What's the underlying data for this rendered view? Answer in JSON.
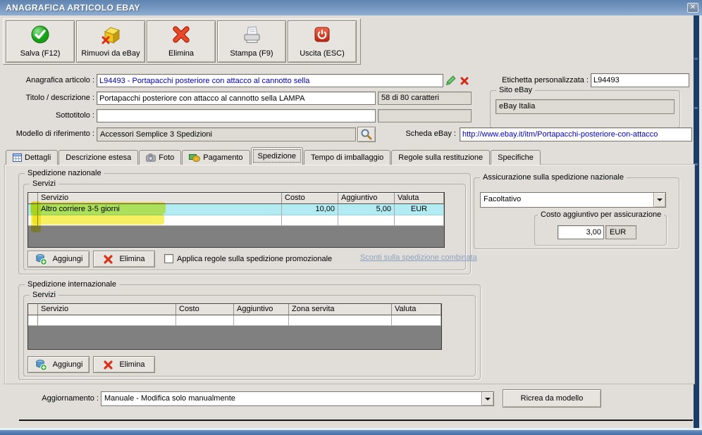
{
  "window": {
    "title": "ANAGRAFICA ARTICOLO EBAY",
    "close_glyph": "✕"
  },
  "toolbar": {
    "buttons": [
      {
        "label": "Salva (F12)",
        "icon": "check-circle-icon"
      },
      {
        "label": "Rimuovi da eBay",
        "icon": "package-remove-icon"
      },
      {
        "label": "Elimina",
        "icon": "red-x-icon"
      },
      {
        "label": "Stampa (F9)",
        "icon": "printer-icon"
      },
      {
        "label": "Uscita (ESC)",
        "icon": "power-icon"
      }
    ]
  },
  "form": {
    "anagrafica_label": "Anagrafica articolo :",
    "anagrafica_value": "L94493 - Portapacchi posteriore con attacco al cannotto sella",
    "etichetta_label": "Etichetta personalizzata :",
    "etichetta_value": "L94493",
    "titolo_label": "Titolo / descrizione :",
    "titolo_value": "Portapacchi posteriore con attacco al cannotto sella LAMPA",
    "titolo_counter": "58 di 80 caratteri",
    "sito_group": "Sito eBay",
    "sito_value": "eBay Italia",
    "sottotitolo_label": "Sottotitolo :",
    "sottotitolo_value": "",
    "modello_label": "Modello di riferimento :",
    "modello_value": "Accessori Semplice 3 Spedizioni",
    "scheda_label": "Scheda eBay :",
    "scheda_value": "http://www.ebay.it/itm/Portapacchi-posteriore-con-attacco"
  },
  "tabs": {
    "items": [
      {
        "label": "Dettagli"
      },
      {
        "label": "Descrizione estesa"
      },
      {
        "label": "Foto"
      },
      {
        "label": "Pagamento"
      },
      {
        "label": "Spedizione"
      },
      {
        "label": "Tempo di imballaggio"
      },
      {
        "label": "Regole sulla restituzione"
      },
      {
        "label": "Specifiche"
      }
    ],
    "active": "Spedizione"
  },
  "national": {
    "group_title": "Spedizione nazionale",
    "services_title": "Servizi",
    "table": {
      "headers": [
        "Servizio",
        "Costo",
        "Aggiuntivo",
        "Valuta"
      ],
      "rows": [
        {
          "servizio": "Altro corriere 3-5 giorni",
          "costo": "10,00",
          "aggiuntivo": "5,00",
          "valuta": "EUR"
        }
      ]
    },
    "add_label": "Aggiungi",
    "delete_label": "Elimina",
    "checkbox_label": "Applica regole sulla spedizione promozionale",
    "checkbox_checked": false,
    "link_label": "Sconti sulla spedizione combinata"
  },
  "insurance": {
    "group_title": "Assicurazione sulla spedizione nazionale",
    "dropdown_value": "Facoltativo",
    "cost_group": "Costo aggiuntivo per assicurazione",
    "cost_value": "3,00",
    "currency": "EUR"
  },
  "international": {
    "group_title": "Spedizione internazionale",
    "services_title": "Servizi",
    "table": {
      "headers": [
        "Servizio",
        "Costo",
        "Aggiuntivo",
        "Zona servita",
        "Valuta"
      ],
      "rows": []
    },
    "add_label": "Aggiungi",
    "delete_label": "Elimina"
  },
  "footer": {
    "update_label": "Aggiornamento :",
    "update_value": "Manuale - Modifica solo manualmente",
    "recreate_label": "Ricrea da modello"
  },
  "colors": {
    "titlebar_blue": "#7899c2",
    "selected_row_cyan": "#b2ecf2",
    "marker_yellow": "#f2e900",
    "link_blue_gray": "#8aa2c0",
    "value_navy": "#0000b4",
    "grid_gray": "#808080"
  }
}
